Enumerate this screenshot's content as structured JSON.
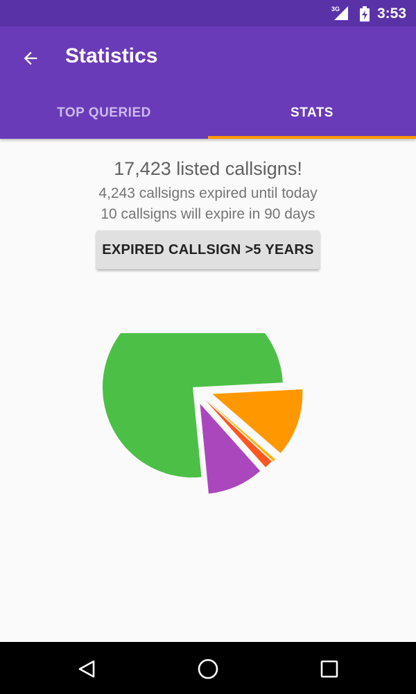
{
  "status_bar": {
    "network": "3G",
    "time": "3:53"
  },
  "app_bar": {
    "title": "Statistics"
  },
  "tabs": [
    {
      "label": "TOP QUERIED",
      "active": false
    },
    {
      "label": "STATS",
      "active": true
    }
  ],
  "stats": {
    "headline": "17,423 listed callsigns!",
    "expired_line": "4,243 callsigns expired until today",
    "expiring_line": "10 callsigns will expire in 90 days",
    "button_label": "EXPIRED CALLSIGN >5 YEARS"
  },
  "colors": {
    "status_bar": "#5a32a8",
    "app_bar": "#6a3bb8",
    "tab_indicator": "#ff9800"
  },
  "chart_data": {
    "type": "pie",
    "exploded": true,
    "slices": [
      {
        "value": 75.7,
        "color": "#4cbf47"
      },
      {
        "value": 12.2,
        "color": "#ff9800"
      },
      {
        "value": 0.5,
        "color": "#ffb300"
      },
      {
        "value": 1.5,
        "color": "#ff5722"
      },
      {
        "value": 10.1,
        "color": "#ab47bc"
      }
    ]
  },
  "nav_bar": {
    "icons": [
      "back-triangle-icon",
      "home-circle-icon",
      "recents-square-icon"
    ]
  }
}
